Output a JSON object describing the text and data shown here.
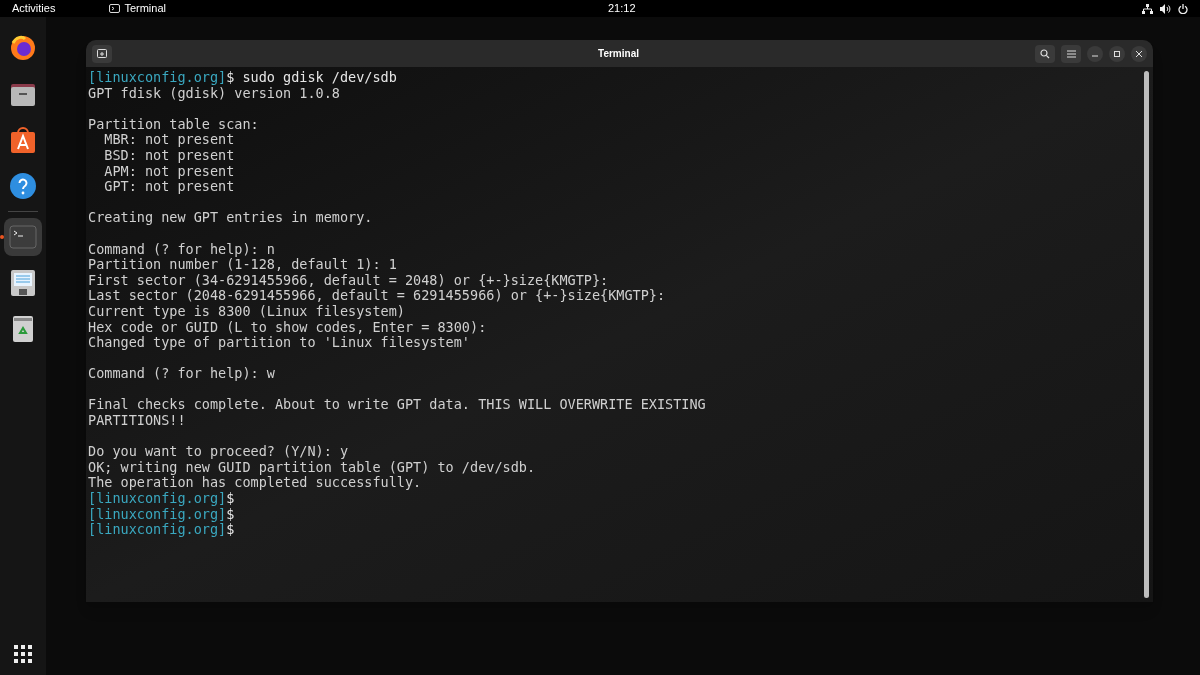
{
  "top_bar": {
    "activities": "Activities",
    "app": "Terminal",
    "clock": "21:12"
  },
  "dock": {
    "items": [
      {
        "kind": "browser",
        "selected": false,
        "running": false
      },
      {
        "kind": "files",
        "selected": false,
        "running": false
      },
      {
        "kind": "store",
        "selected": false,
        "running": false
      },
      {
        "kind": "help",
        "selected": false,
        "running": false
      },
      {
        "kind": "terminal",
        "selected": true,
        "running": true
      },
      {
        "kind": "document",
        "selected": false,
        "running": false
      },
      {
        "kind": "trash",
        "selected": false,
        "running": false
      }
    ]
  },
  "window": {
    "title": "Terminal",
    "lines": [
      {
        "kind": "prompt",
        "prompt": "[linuxconfig.org]",
        "text": "$ sudo gdisk /dev/sdb"
      },
      {
        "kind": "output",
        "text": "GPT fdisk (gdisk) version 1.0.8"
      },
      {
        "kind": "blank"
      },
      {
        "kind": "output",
        "text": "Partition table scan:"
      },
      {
        "kind": "output",
        "text": "  MBR: not present"
      },
      {
        "kind": "output",
        "text": "  BSD: not present"
      },
      {
        "kind": "output",
        "text": "  APM: not present"
      },
      {
        "kind": "output",
        "text": "  GPT: not present"
      },
      {
        "kind": "blank"
      },
      {
        "kind": "output",
        "text": "Creating new GPT entries in memory."
      },
      {
        "kind": "blank"
      },
      {
        "kind": "output",
        "text": "Command (? for help): n"
      },
      {
        "kind": "output",
        "text": "Partition number (1-128, default 1): 1"
      },
      {
        "kind": "output",
        "text": "First sector (34-6291455966, default = 2048) or {+-}size{KMGTP}:"
      },
      {
        "kind": "output",
        "text": "Last sector (2048-6291455966, default = 6291455966) or {+-}size{KMGTP}:"
      },
      {
        "kind": "output",
        "text": "Current type is 8300 (Linux filesystem)"
      },
      {
        "kind": "output",
        "text": "Hex code or GUID (L to show codes, Enter = 8300):"
      },
      {
        "kind": "output",
        "text": "Changed type of partition to 'Linux filesystem'"
      },
      {
        "kind": "blank"
      },
      {
        "kind": "output",
        "text": "Command (? for help): w"
      },
      {
        "kind": "blank"
      },
      {
        "kind": "output",
        "text": "Final checks complete. About to write GPT data. THIS WILL OVERWRITE EXISTING"
      },
      {
        "kind": "output",
        "text": "PARTITIONS!!"
      },
      {
        "kind": "blank"
      },
      {
        "kind": "output",
        "text": "Do you want to proceed? (Y/N): y"
      },
      {
        "kind": "output",
        "text": "OK; writing new GUID partition table (GPT) to /dev/sdb."
      },
      {
        "kind": "output",
        "text": "The operation has completed successfully."
      },
      {
        "kind": "prompt",
        "prompt": "[linuxconfig.org]",
        "text": "$"
      },
      {
        "kind": "prompt",
        "prompt": "[linuxconfig.org]",
        "text": "$"
      },
      {
        "kind": "prompt",
        "prompt": "[linuxconfig.org]",
        "text": "$"
      }
    ]
  }
}
